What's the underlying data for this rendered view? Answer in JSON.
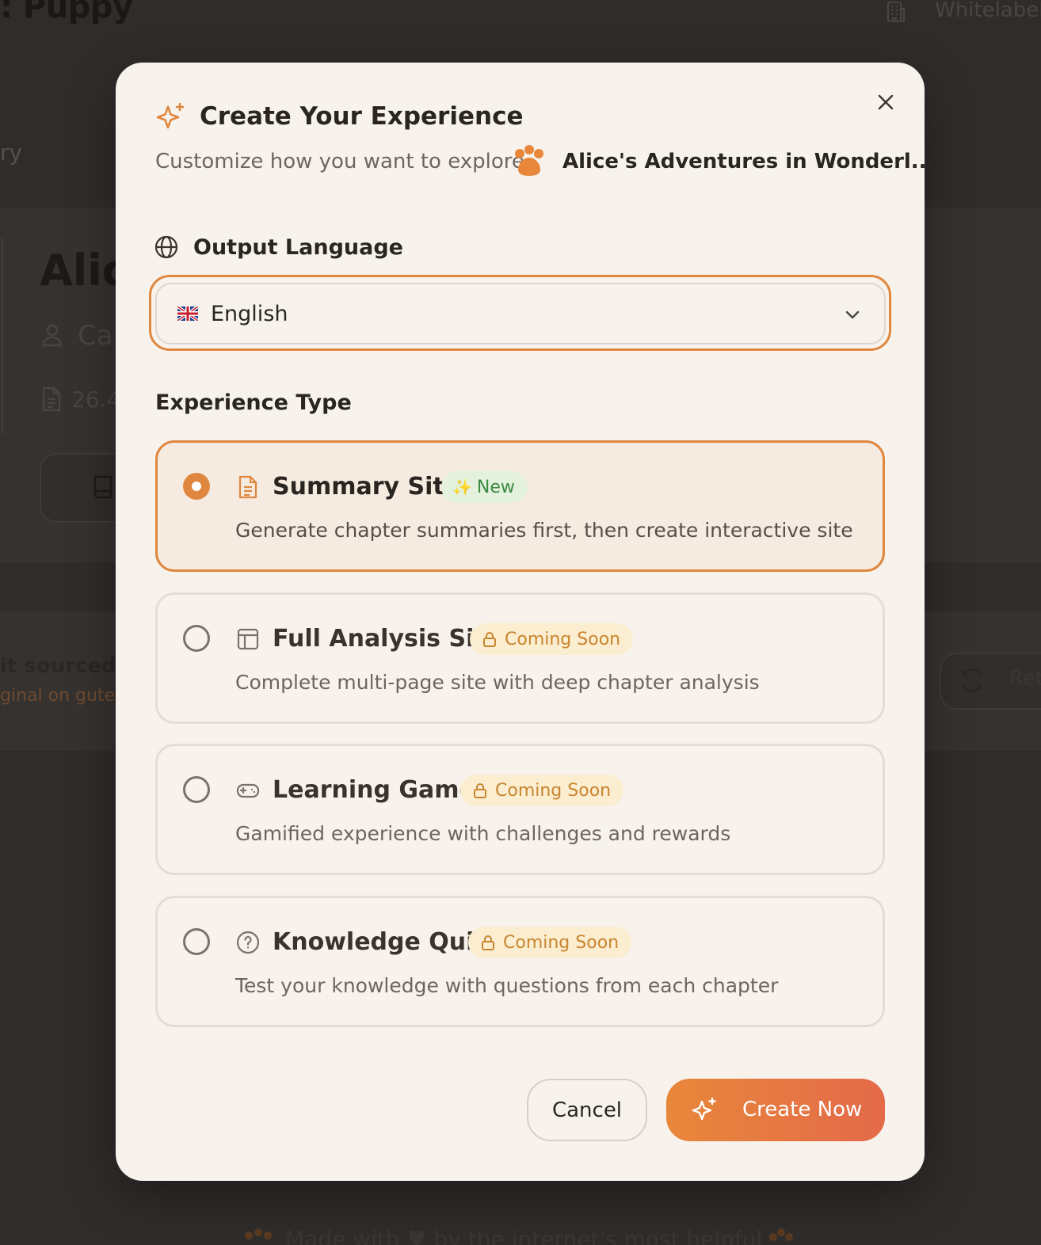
{
  "background": {
    "brand": ": Puppy",
    "whitelabel": "Whitelabel",
    "crumb": "ry",
    "book_title": "Alic",
    "author": "Ca",
    "size": "26.4",
    "source_line1": "it sourced fr",
    "source_line2": "ginal on guten",
    "retry_label": "Ret",
    "footer_text": "Made with ♥ by the internet's most helpful"
  },
  "modal": {
    "title": "Create Your Experience",
    "subtitle": "Customize how you want to explore",
    "book_name": "Alice's Adventures in Wonderl...",
    "close_icon": "close-icon",
    "language_section": {
      "label": "Output Language",
      "selected_value": "English",
      "flag": "uk-flag-icon"
    },
    "experience_section": {
      "label": "Experience Type",
      "options": [
        {
          "title": "Summary Site",
          "badge": "New",
          "badge_icon": "✨",
          "description": "Generate chapter summaries first, then create interactive site",
          "selected": true,
          "icon": "document-icon"
        },
        {
          "title": "Full Analysis Site",
          "badge": "Coming Soon",
          "description": "Complete multi-page site with deep chapter analysis",
          "selected": false,
          "icon": "layout-icon"
        },
        {
          "title": "Learning Game",
          "badge": "Coming Soon",
          "description": "Gamified experience with challenges and rewards",
          "selected": false,
          "icon": "gamepad-icon"
        },
        {
          "title": "Knowledge Quiz",
          "badge": "Coming Soon",
          "description": "Test your knowledge with questions from each chapter",
          "selected": false,
          "icon": "question-circle-icon"
        }
      ]
    },
    "buttons": {
      "cancel": "Cancel",
      "create": "Create Now"
    }
  },
  "colors": {
    "accent": "#e0873f",
    "accent_gradient_end": "#e46a4a",
    "modal_bg": "#f7f3ec",
    "new_badge_bg": "#e3f1dd",
    "new_badge_text": "#3c8a42",
    "soon_badge_bg": "#fbedcf",
    "soon_badge_text": "#c9852f"
  }
}
